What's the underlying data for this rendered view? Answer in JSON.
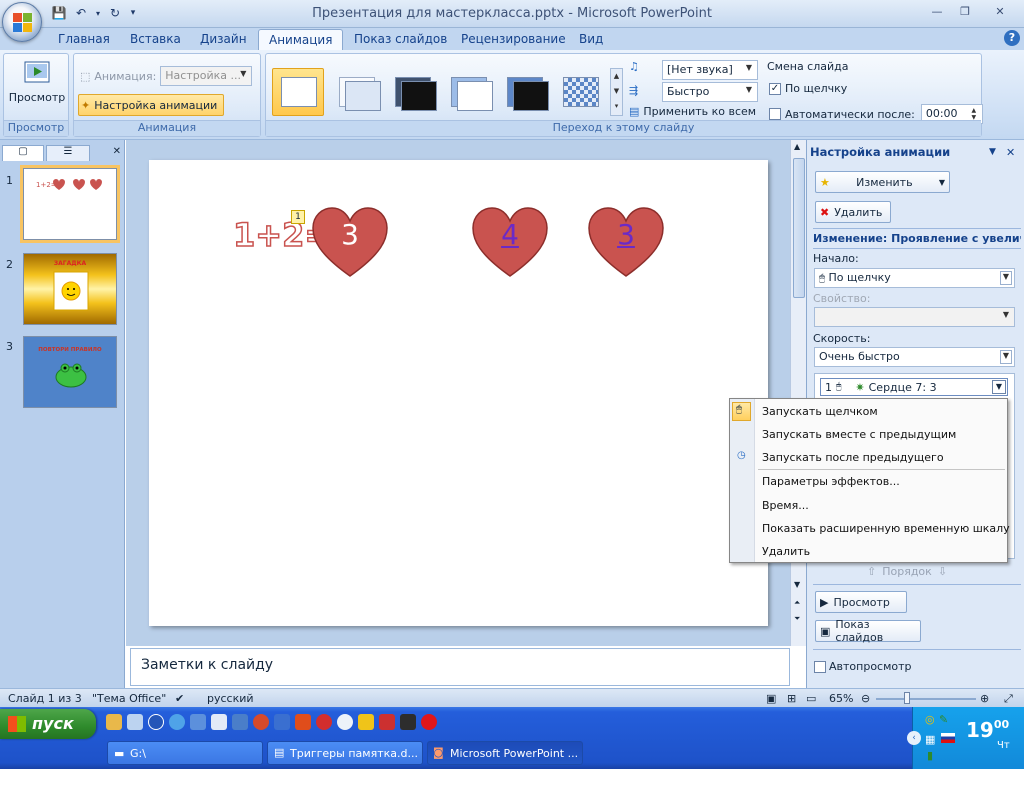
{
  "window": {
    "title": "Презентация для мастеркласса.pptx - Microsoft PowerPoint"
  },
  "ribbon": {
    "tabs": [
      "Главная",
      "Вставка",
      "Дизайн",
      "Анимация",
      "Показ слайдов",
      "Рецензирование",
      "Вид"
    ],
    "active_tab": "Анимация",
    "groups": {
      "preview": {
        "label": "Просмотр",
        "button": "Просмотр"
      },
      "animations": {
        "label": "Анимация",
        "animation_label": "Анимация:",
        "animation_value": "Настройка ...",
        "custom_button": "Настройка анимации"
      },
      "transition": {
        "label": "Переход к этому слайду",
        "sound": "[Нет звука]",
        "speed": "Быстро",
        "apply_all": "Применить ко всем",
        "advance_title": "Смена слайда",
        "on_click": "По щелчку",
        "auto_after": "Автоматически после:",
        "auto_time": "00:00"
      }
    }
  },
  "slides_pane": {
    "slides": [
      {
        "num": "1"
      },
      {
        "num": "2"
      },
      {
        "num": "3"
      }
    ],
    "thumb2_text": "ЗАГАДКА",
    "thumb3_text": "ПОВТОРИ ПРАВИЛО"
  },
  "slide": {
    "equation": "1+2=",
    "anim_marker": "1",
    "hearts": [
      "3",
      "4",
      "3"
    ]
  },
  "notes": {
    "placeholder": "Заметки к слайду"
  },
  "task_pane": {
    "title": "Настройка анимации",
    "change_button": "Изменить",
    "delete_button": "Удалить",
    "effect_heading": "Изменение: Проявление с увеличением",
    "start_label": "Начало:",
    "start_value": "По щелчку",
    "property_label": "Свойство:",
    "speed_label": "Скорость:",
    "speed_value": "Очень быстро",
    "list_item": {
      "num": "1",
      "name": "Сердце 7: 3"
    },
    "order_label": "Порядок",
    "play_button": "Просмотр",
    "slideshow_button": "Показ слайдов",
    "autopreview": "Автопросмотр"
  },
  "context_menu": {
    "items": [
      "Запускать щелчком",
      "Запускать вместе с предыдущим",
      "Запускать после предыдущего",
      "Параметры эффектов...",
      "Время...",
      "Показать расширенную временную шкалу",
      "Удалить"
    ]
  },
  "status_bar": {
    "slide_info": "Слайд 1 из 3",
    "theme": "\"Тема Office\"",
    "language": "русский",
    "zoom": "65%"
  },
  "taskbar": {
    "start": "пуск",
    "buttons": [
      "G:\\",
      "Триггеры памятка.d...",
      "Microsoft PowerPoint ..."
    ],
    "clock_hours": "19",
    "clock_minutes": "00",
    "day": "Чт"
  },
  "colors": {
    "heart": "#c9534f",
    "heart_stroke": "#8c2e2b",
    "accent": "#15428b",
    "selection": "#ffc84d"
  }
}
